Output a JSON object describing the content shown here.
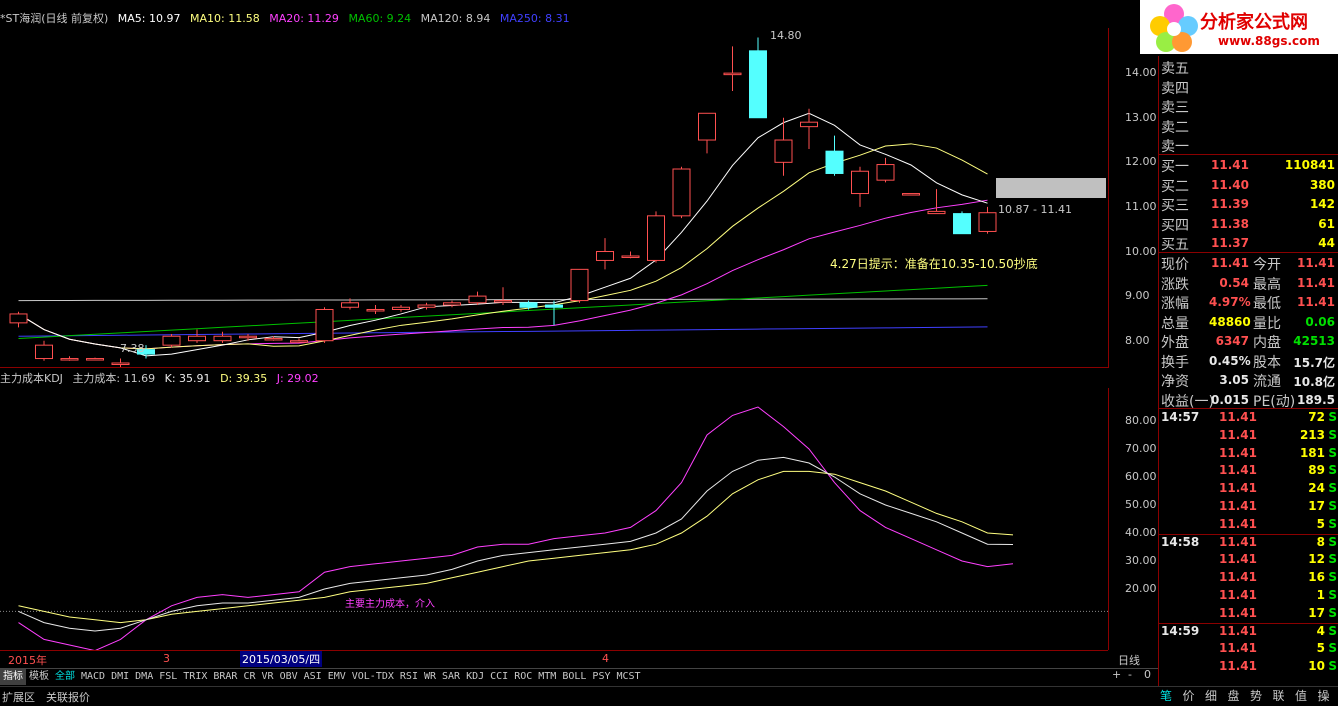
{
  "top_legend": {
    "title": "*ST海润(日线 前复权)",
    "ma5": "MA5: 10.97",
    "ma10": "MA10: 11.58",
    "ma20": "MA20: 11.29",
    "ma60": "MA60: 9.24",
    "ma120": "MA120: 8.94",
    "ma250": "MA250: 8.31"
  },
  "price_axis": [
    "14.00",
    "13.00",
    "12.00",
    "11.00",
    "10.00",
    "9.00",
    "8.00"
  ],
  "annotations": {
    "high": "14.80",
    "low": "7.38",
    "range": "10.87 - 11.41",
    "hint": "4.27日提示：准备在10.35-10.50抄底",
    "cross_text": "主要主力成本，介入"
  },
  "kdj_legend": {
    "title": "主力成本KDJ",
    "cost": "主力成本: 11.69",
    "k": "K: 35.91",
    "d": "D: 39.35",
    "j": "J: 29.02"
  },
  "kdj_axis": [
    "80.00",
    "70.00",
    "60.00",
    "50.00",
    "40.00",
    "30.00",
    "20.00"
  ],
  "x_axis": {
    "year": "2015年",
    "m3": "3",
    "date": "2015/03/05/四",
    "m4": "4",
    "period": "日线"
  },
  "order_book": {
    "sells": [
      {
        "label": "卖五"
      },
      {
        "label": "卖四"
      },
      {
        "label": "卖三"
      },
      {
        "label": "卖二"
      },
      {
        "label": "卖一"
      }
    ],
    "buys": [
      {
        "label": "买一",
        "price": "11.41",
        "vol": "110841"
      },
      {
        "label": "买二",
        "price": "11.40",
        "vol": "380"
      },
      {
        "label": "买三",
        "price": "11.39",
        "vol": "142"
      },
      {
        "label": "买四",
        "price": "11.38",
        "vol": "61"
      },
      {
        "label": "买五",
        "price": "11.37",
        "vol": "44"
      }
    ]
  },
  "quote": {
    "rows": [
      {
        "l1": "现价",
        "v1": "11.41",
        "l2": "今开",
        "v2": "11.41"
      },
      {
        "l1": "涨跌",
        "v1": "0.54",
        "l2": "最高",
        "v2": "11.41"
      },
      {
        "l1": "涨幅",
        "v1": "4.97%",
        "l2": "最低",
        "v2": "11.41"
      },
      {
        "l1": "总量",
        "v1": "48860",
        "l2": "量比",
        "v2": "0.06"
      },
      {
        "l1": "外盘",
        "v1": "6347",
        "l2": "内盘",
        "v2": "42513"
      },
      {
        "l1": "换手",
        "v1": "0.45%",
        "l2": "股本",
        "v2": "15.7亿"
      },
      {
        "l1": "净资",
        "v1": "3.05",
        "l2": "流通",
        "v2": "10.8亿"
      },
      {
        "l1": "收益(一)",
        "v1": "0.015",
        "l2": "PE(动)",
        "v2": "189.5"
      }
    ]
  },
  "trades": [
    {
      "time": "14:57",
      "price": "11.41",
      "vol": "72",
      "side": "S"
    },
    {
      "time": "",
      "price": "11.41",
      "vol": "213",
      "side": "S"
    },
    {
      "time": "",
      "price": "11.41",
      "vol": "181",
      "side": "S"
    },
    {
      "time": "",
      "price": "11.41",
      "vol": "89",
      "side": "S"
    },
    {
      "time": "",
      "price": "11.41",
      "vol": "24",
      "side": "S"
    },
    {
      "time": "",
      "price": "11.41",
      "vol": "17",
      "side": "S"
    },
    {
      "time": "",
      "price": "11.41",
      "vol": "5",
      "side": "S"
    },
    {
      "time": "14:58",
      "price": "11.41",
      "vol": "8",
      "side": "S"
    },
    {
      "time": "",
      "price": "11.41",
      "vol": "12",
      "side": "S"
    },
    {
      "time": "",
      "price": "11.41",
      "vol": "16",
      "side": "S"
    },
    {
      "time": "",
      "price": "11.41",
      "vol": "1",
      "side": "S"
    },
    {
      "time": "",
      "price": "11.41",
      "vol": "17",
      "side": "S"
    },
    {
      "time": "14:59",
      "price": "11.41",
      "vol": "4",
      "side": "S"
    },
    {
      "time": "",
      "price": "11.41",
      "vol": "5",
      "side": "S"
    },
    {
      "time": "",
      "price": "11.41",
      "vol": "10",
      "side": "S"
    }
  ],
  "tabs": [
    "指标",
    "模板",
    "全部",
    "MACD",
    "DMI",
    "DMA",
    "FSL",
    "TRIX",
    "BRAR",
    "CR",
    "VR",
    "OBV",
    "ASI",
    "EMV",
    "VOL-TDX",
    "RSI",
    "WR",
    "SAR",
    "KDJ",
    "CCI",
    "ROC",
    "MTM",
    "BOLL",
    "PSY",
    "MCST"
  ],
  "tab_controls": [
    "+",
    "-",
    "0"
  ],
  "status": [
    "扩展区",
    "关联报价"
  ],
  "side_tabs": [
    "笔",
    "价",
    "细",
    "盘",
    "势",
    "联",
    "值",
    "操"
  ],
  "logo": {
    "text": "分析家公式网",
    "url": "www.88gs.com"
  },
  "colors": {
    "up": "#ff5050",
    "down": "#54ffff",
    "ma5": "#ffffff",
    "ma10": "#ffff80",
    "ma20": "#ff40ff",
    "ma60": "#00c000",
    "ma120": "#c8c8c8",
    "ma250": "#4040ff"
  },
  "chart_data": {
    "type": "candlestick",
    "ylim": [
      7.5,
      14.9
    ],
    "candles": [
      {
        "o": 8.4,
        "c": 8.6,
        "h": 8.65,
        "l": 8.3
      },
      {
        "o": 7.6,
        "c": 7.9,
        "h": 8.0,
        "l": 7.55
      },
      {
        "o": 7.6,
        "c": 7.6,
        "h": 7.65,
        "l": 7.55
      },
      {
        "o": 7.6,
        "c": 7.6,
        "h": 7.62,
        "l": 7.58
      },
      {
        "o": 7.5,
        "c": 7.5,
        "h": 7.6,
        "l": 7.38
      },
      {
        "o": 7.8,
        "c": 7.7,
        "h": 7.9,
        "l": 7.6
      },
      {
        "o": 7.9,
        "c": 8.1,
        "h": 8.15,
        "l": 7.85
      },
      {
        "o": 8.0,
        "c": 8.1,
        "h": 8.25,
        "l": 7.95
      },
      {
        "o": 8.0,
        "c": 8.1,
        "h": 8.2,
        "l": 7.95
      },
      {
        "o": 8.1,
        "c": 8.1,
        "h": 8.15,
        "l": 8.0
      },
      {
        "o": 8.05,
        "c": 8.05,
        "h": 8.1,
        "l": 8.0
      },
      {
        "o": 8.0,
        "c": 8.0,
        "h": 8.05,
        "l": 7.95
      },
      {
        "o": 8.0,
        "c": 8.7,
        "h": 8.75,
        "l": 7.95
      },
      {
        "o": 8.75,
        "c": 8.85,
        "h": 8.95,
        "l": 8.7
      },
      {
        "o": 8.7,
        "c": 8.7,
        "h": 8.8,
        "l": 8.6
      },
      {
        "o": 8.7,
        "c": 8.75,
        "h": 8.8,
        "l": 8.65
      },
      {
        "o": 8.75,
        "c": 8.8,
        "h": 8.85,
        "l": 8.7
      },
      {
        "o": 8.8,
        "c": 8.85,
        "h": 8.9,
        "l": 8.75
      },
      {
        "o": 8.85,
        "c": 9.0,
        "h": 9.1,
        "l": 8.8
      },
      {
        "o": 8.9,
        "c": 8.9,
        "h": 9.2,
        "l": 8.8
      },
      {
        "o": 8.85,
        "c": 8.75,
        "h": 8.9,
        "l": 8.7
      },
      {
        "o": 8.8,
        "c": 8.75,
        "h": 8.9,
        "l": 8.35
      },
      {
        "o": 8.9,
        "c": 9.6,
        "h": 9.6,
        "l": 8.85
      },
      {
        "o": 9.8,
        "c": 10.0,
        "h": 10.3,
        "l": 9.6
      },
      {
        "o": 9.9,
        "c": 9.9,
        "h": 10.0,
        "l": 9.85
      },
      {
        "o": 9.8,
        "c": 10.8,
        "h": 10.9,
        "l": 9.75
      },
      {
        "o": 10.8,
        "c": 11.85,
        "h": 11.9,
        "l": 10.75
      },
      {
        "o": 12.5,
        "c": 13.1,
        "h": 13.1,
        "l": 12.2
      },
      {
        "o": 14.0,
        "c": 14.0,
        "h": 14.6,
        "l": 13.6
      },
      {
        "o": 14.5,
        "c": 13.0,
        "h": 14.8,
        "l": 13.0
      },
      {
        "o": 12.0,
        "c": 12.5,
        "h": 13.0,
        "l": 11.7
      },
      {
        "o": 12.8,
        "c": 12.9,
        "h": 13.2,
        "l": 12.3
      },
      {
        "o": 12.25,
        "c": 11.75,
        "h": 12.6,
        "l": 11.7
      },
      {
        "o": 11.3,
        "c": 11.8,
        "h": 11.9,
        "l": 11.0
      },
      {
        "o": 11.6,
        "c": 11.95,
        "h": 12.1,
        "l": 11.55
      },
      {
        "o": 11.3,
        "c": 11.3,
        "h": 11.3,
        "l": 11.3
      },
      {
        "o": 10.85,
        "c": 10.9,
        "h": 11.4,
        "l": 10.85
      },
      {
        "o": 10.85,
        "c": 10.4,
        "h": 10.9,
        "l": 10.4
      },
      {
        "o": 10.45,
        "c": 10.87,
        "h": 11.0,
        "l": 10.4
      }
    ],
    "kdj": {
      "ylim": [
        0,
        90
      ],
      "k": [
        12,
        8,
        6,
        5,
        6,
        9,
        12,
        14,
        15,
        15,
        16,
        17,
        20,
        22,
        23,
        24,
        25,
        27,
        30,
        32,
        33,
        34,
        35,
        36,
        37,
        40,
        45,
        55,
        62,
        66,
        67,
        65,
        60,
        54,
        50,
        47,
        44,
        40,
        36,
        35.9
      ],
      "d": [
        14,
        12,
        10,
        9,
        8,
        9,
        11,
        12,
        13,
        14,
        15,
        16,
        17,
        19,
        20,
        21,
        22,
        24,
        26,
        28,
        30,
        31,
        32,
        33,
        34,
        36,
        40,
        46,
        54,
        59,
        62,
        62,
        61,
        58,
        55,
        51,
        47,
        44,
        40,
        39.35
      ],
      "j": [
        8,
        2,
        0,
        -2,
        2,
        9,
        14,
        17,
        18,
        17,
        18,
        19,
        26,
        28,
        29,
        30,
        31,
        32,
        35,
        36,
        36,
        38,
        39,
        40,
        42,
        48,
        58,
        75,
        82,
        85,
        78,
        70,
        58,
        48,
        42,
        38,
        34,
        30,
        28,
        29.02
      ]
    }
  }
}
